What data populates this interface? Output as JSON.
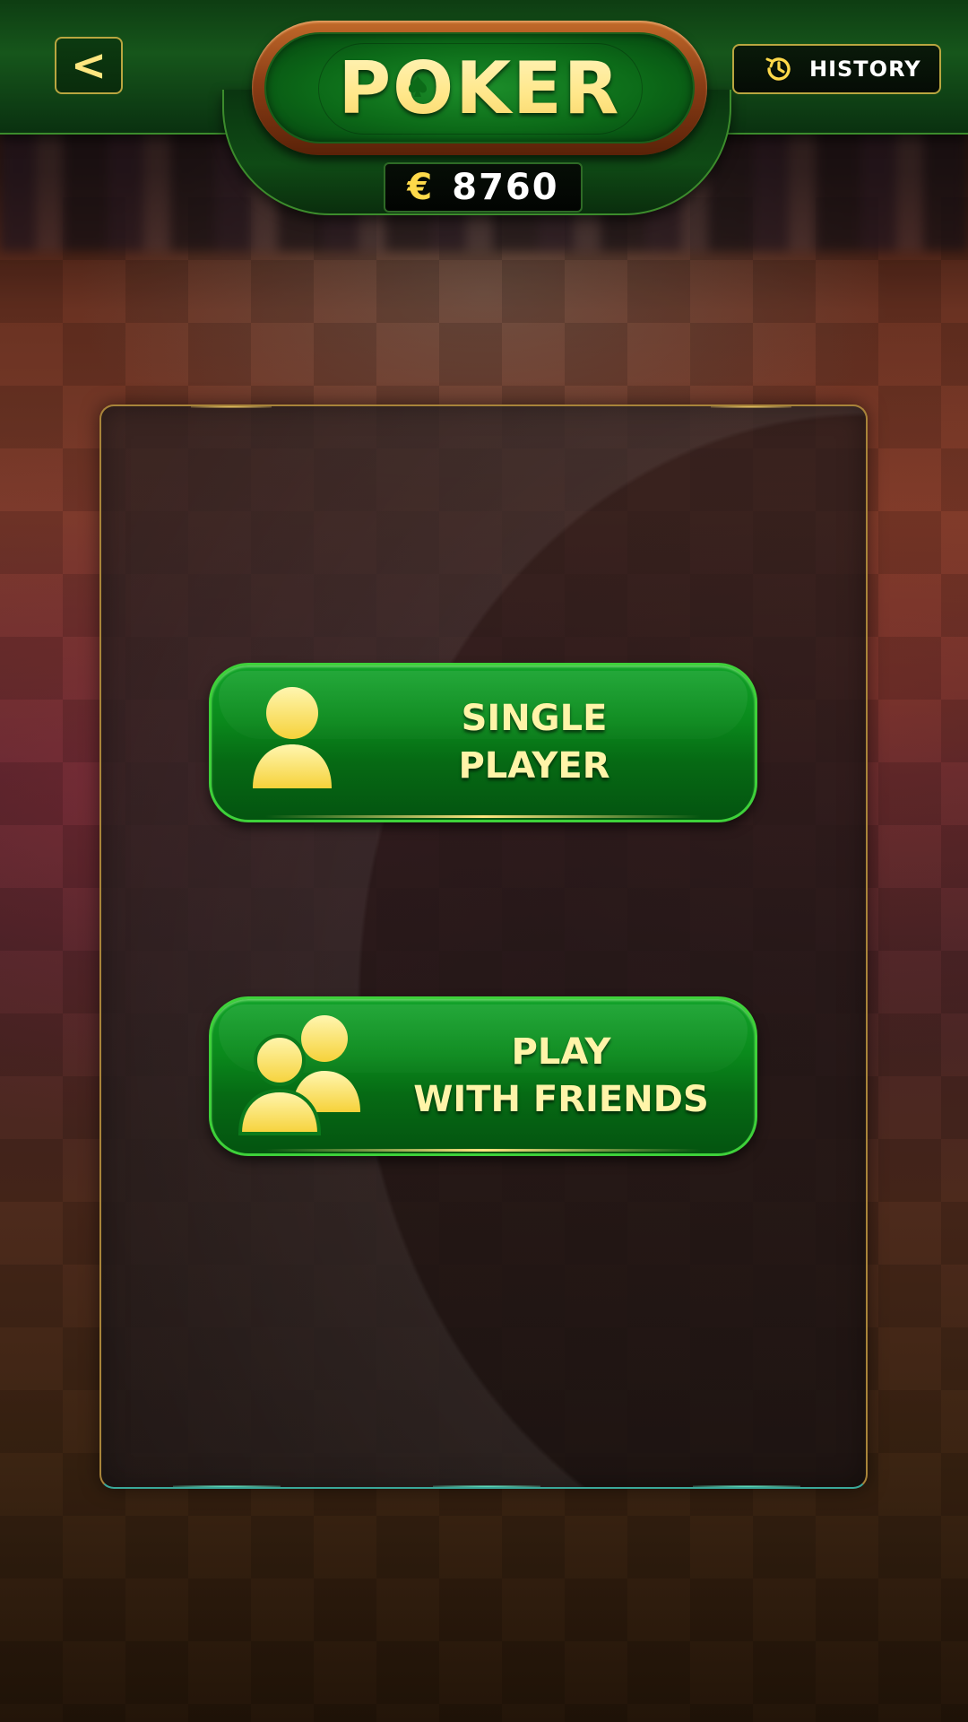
{
  "header": {
    "back_label": "<",
    "title": "POKER",
    "history_label": "HISTORY",
    "currency_symbol": "€",
    "balance": "8760"
  },
  "menu": {
    "single_player_line1": "SINGLE",
    "single_player_line2": "PLAYER",
    "friends_line1": "PLAY",
    "friends_line2": "WITH FRIENDS"
  },
  "colors": {
    "accent_gold": "#ffe680",
    "button_green": "#0a8a1c",
    "header_green": "#16561b"
  },
  "icons": {
    "back": "chevron-left-icon",
    "history": "history-clock-icon",
    "title_spade": "spade-icon",
    "single_player": "person-icon",
    "friends": "people-icon"
  }
}
